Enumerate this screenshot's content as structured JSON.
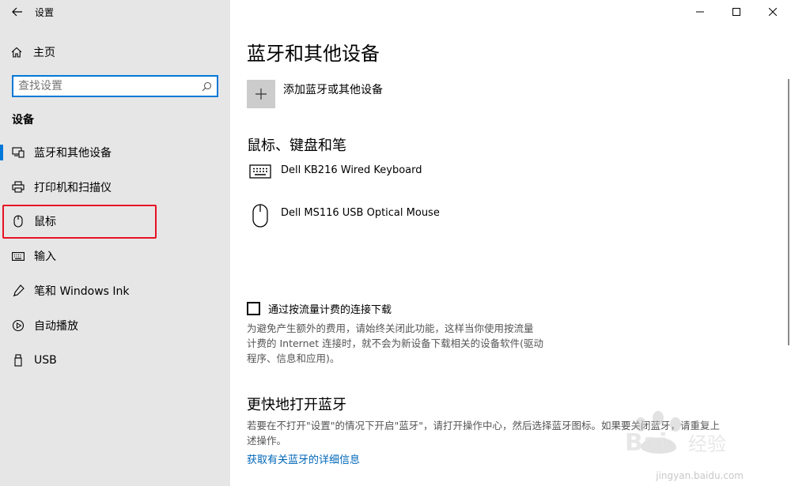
{
  "app": {
    "title": "设置"
  },
  "sidebar": {
    "home_label": "主页",
    "search_placeholder": "查找设置",
    "section_label": "设备",
    "items": [
      {
        "label": "蓝牙和其他设备",
        "icon": "bluetooth-devices-icon",
        "active": true
      },
      {
        "label": "打印机和扫描仪",
        "icon": "printer-icon",
        "active": false
      },
      {
        "label": "鼠标",
        "icon": "mouse-icon",
        "active": false
      },
      {
        "label": "输入",
        "icon": "keyboard-icon",
        "active": false
      },
      {
        "label": "笔和 Windows Ink",
        "icon": "pen-icon",
        "active": false
      },
      {
        "label": "自动播放",
        "icon": "autoplay-icon",
        "active": false
      },
      {
        "label": "USB",
        "icon": "usb-icon",
        "active": false
      }
    ]
  },
  "main": {
    "page_title": "蓝牙和其他设备",
    "add_device_label": "添加蓝牙或其他设备",
    "mouse_keyboard_section": "鼠标、键盘和笔",
    "devices": [
      {
        "name": "Dell KB216 Wired Keyboard",
        "icon": "keyboard-icon"
      },
      {
        "name": "Dell MS116 USB Optical Mouse",
        "icon": "mouse-icon"
      }
    ],
    "metered_checkbox_label": "通过按流量计费的连接下载",
    "metered_desc_lines": [
      "为避免产生额外的费用，请始终关闭此功能，这样当你使用按流量",
      "计费的 Internet 连接时，就不会为新设备下载相关的设备软件(驱动",
      "程序、信息和应用)。"
    ],
    "quick_section": "更快地打开蓝牙",
    "quick_desc_lines": [
      "若要在不打开\"设置\"的情况下开启\"蓝牙\"，请打开操作中心，然后选择蓝牙图标。如果要关闭蓝牙，请重复上",
      "述操作。"
    ],
    "details_link": "获取有关蓝牙的详细信息"
  },
  "watermark": {
    "text": "jingyan.baidu.com",
    "logo": "Baidu 经验"
  }
}
